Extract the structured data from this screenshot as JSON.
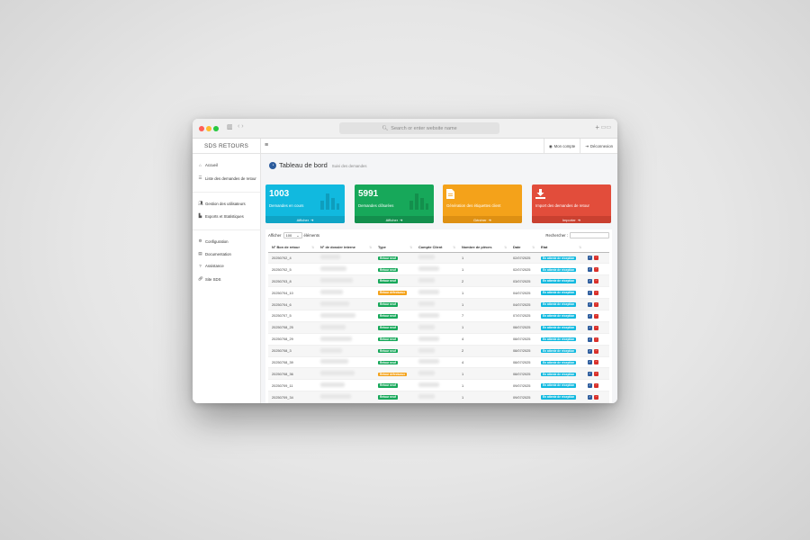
{
  "browser": {
    "address_placeholder": "Search or enter website name",
    "sidebar_glyph": "▥",
    "nav_glyph": "‹ ›",
    "plus_glyph": "+",
    "tabs_glyph": "▭▭"
  },
  "app": {
    "brand": "SDS RETOURS",
    "menu_glyph": "≡",
    "account_label": "Mon compte",
    "logout_label": "Déconnexion"
  },
  "sidebar": {
    "items": [
      {
        "label": "Accueil",
        "icon": "home-icon"
      },
      {
        "label": "Liste des demandes de retour",
        "icon": "list-icon"
      },
      {
        "label": "Gestion des utilisateurs",
        "icon": "users-icon"
      },
      {
        "label": "Exports et Statistiques",
        "icon": "chart-icon"
      },
      {
        "label": "Configuration",
        "icon": "gear-icon"
      },
      {
        "label": "Documentation",
        "icon": "book-icon"
      },
      {
        "label": "Assistance",
        "icon": "question-icon"
      },
      {
        "label": "Site SDS",
        "icon": "link-icon"
      }
    ]
  },
  "page": {
    "title": "Tableau de bord",
    "subtitle": "Suivi des demandes"
  },
  "cards": [
    {
      "value": "1003",
      "label": "Demandes en cours",
      "footer": "Afficher",
      "color": "#11b9df"
    },
    {
      "value": "5991",
      "label": "Demandes clôturées",
      "footer": "Afficher",
      "color": "#17a85a"
    },
    {
      "value": "",
      "label": "Génération des étiquettes client",
      "footer": "Générer",
      "color": "#f4a21a"
    },
    {
      "value": "",
      "label": "Import des demandes de retour",
      "footer": "Importer",
      "color": "#e24d3b"
    }
  ],
  "table": {
    "show_label": "Afficher",
    "show_value": "100",
    "elements_label": "éléments",
    "search_label": "Rechercher :",
    "columns": [
      "N° Bon de retour",
      "N° de dossier interne",
      "Type",
      "Compte Client",
      "Nombre de pièces",
      "Date",
      "Etat"
    ],
    "rows": [
      {
        "num": "20250702_4",
        "type": "Retour neuf",
        "type_color": "#17a85a",
        "pieces": "1",
        "date": "02/07/2025",
        "etat": "En attente de réception"
      },
      {
        "num": "20250702_5",
        "type": "Retour neuf",
        "type_color": "#17a85a",
        "pieces": "1",
        "date": "02/07/2025",
        "etat": "En attente de réception"
      },
      {
        "num": "20250703_8",
        "type": "Retour neuf",
        "type_color": "#17a85a",
        "pieces": "2",
        "date": "03/07/2025",
        "etat": "En attente de réception"
      },
      {
        "num": "20250704_10",
        "type": "Retour défectueux",
        "type_color": "#f4a21a",
        "pieces": "1",
        "date": "04/07/2025",
        "etat": "En attente de réception"
      },
      {
        "num": "20250704_6",
        "type": "Retour neuf",
        "type_color": "#17a85a",
        "pieces": "1",
        "date": "04/07/2025",
        "etat": "En attente de réception"
      },
      {
        "num": "20250707_5",
        "type": "Retour neuf",
        "type_color": "#17a85a",
        "pieces": "7",
        "date": "07/07/2025",
        "etat": "En attente de réception"
      },
      {
        "num": "20250708_25",
        "type": "Retour neuf",
        "type_color": "#17a85a",
        "pieces": "1",
        "date": "08/07/2025",
        "etat": "En attente de réception"
      },
      {
        "num": "20250708_29",
        "type": "Retour neuf",
        "type_color": "#17a85a",
        "pieces": "4",
        "date": "08/07/2025",
        "etat": "En attente de réception"
      },
      {
        "num": "20250708_3",
        "type": "Retour neuf",
        "type_color": "#17a85a",
        "pieces": "2",
        "date": "08/07/2025",
        "etat": "En attente de réception"
      },
      {
        "num": "20250708_39",
        "type": "Retour neuf",
        "type_color": "#17a85a",
        "pieces": "4",
        "date": "08/07/2025",
        "etat": "En attente de réception"
      },
      {
        "num": "20250708_36",
        "type": "Retour défectueux",
        "type_color": "#f4a21a",
        "pieces": "1",
        "date": "08/07/2025",
        "etat": "En attente de réception"
      },
      {
        "num": "20250709_11",
        "type": "Retour neuf",
        "type_color": "#17a85a",
        "pieces": "1",
        "date": "09/07/2025",
        "etat": "En attente de réception"
      },
      {
        "num": "20250709_34",
        "type": "Retour neuf",
        "type_color": "#17a85a",
        "pieces": "1",
        "date": "09/07/2025",
        "etat": "En attente de réception"
      }
    ]
  },
  "colors": {
    "accent": "#2b5b9c",
    "etat_badge": "#11b9df",
    "delete": "#d9302a"
  }
}
